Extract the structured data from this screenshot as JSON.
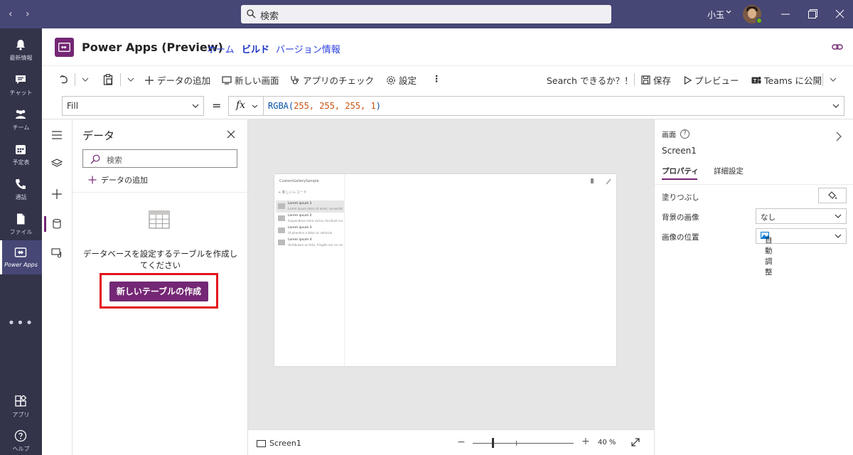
{
  "titlebar": {
    "search_placeholder": "検索",
    "user_name": "小玉"
  },
  "rail": {
    "items": [
      {
        "label": "最新情報",
        "icon": "bell-icon"
      },
      {
        "label": "チャット",
        "icon": "chat-icon"
      },
      {
        "label": "チーム",
        "icon": "teams-icon"
      },
      {
        "label": "予定表",
        "icon": "calendar-icon"
      },
      {
        "label": "通話",
        "icon": "phone-icon"
      },
      {
        "label": "ファイル",
        "icon": "file-icon"
      },
      {
        "label": "Power Apps",
        "icon": "power-apps-icon"
      },
      {
        "label": "アプリ",
        "icon": "apps-icon"
      },
      {
        "label": "ヘルプ",
        "icon": "help-icon"
      }
    ],
    "more": "•••"
  },
  "app_header": {
    "title": "Power Apps (Preview)",
    "nav": [
      "ホーム",
      "ビルド",
      "バージョン情報"
    ]
  },
  "toolbar": {
    "add_data": "データの追加",
    "new_screen": "新しい画面",
    "app_check": "アプリのチェック",
    "settings": "設定",
    "search": "Search できるか？！",
    "save": "保存",
    "preview": "プレビュー",
    "publish": "Teams に公開"
  },
  "formula_bar": {
    "property": "Fill",
    "fx": "fx",
    "formula_fn": "RGBA(",
    "formula_args": "255, 255, 255, 1",
    "formula_close": ")"
  },
  "data_panel": {
    "title": "データ",
    "search_placeholder": "検索",
    "add_data": "データの追加",
    "message": "データベースを設定するテーブルを作成してください",
    "create_button": "新しいテーブルの作成"
  },
  "canvas": {
    "screen_title": "CustomGallerySample",
    "add_record": "新しいレコード",
    "gallery": [
      {
        "title": "Lorem ipsum 1",
        "subtitle": "Lorem ipsum dolor sit amet, consectetur"
      },
      {
        "title": "Lorem ipsum 2",
        "subtitle": "Suspendisse enim varius, tincidunt sue"
      },
      {
        "title": "Lorem ipsum 3",
        "subtitle": "Ut pharetra a dolor ac vehicula"
      },
      {
        "title": "Lorem ipsum 4",
        "subtitle": "Vestibulum ou felis, fringilla nec ex nisi"
      }
    ]
  },
  "statusbar": {
    "screen_name": "Screen1",
    "zoom": "40 %",
    "zoom_level": 0.4
  },
  "properties": {
    "header": "画面",
    "name": "Screen1",
    "tabs": [
      "プロパティ",
      "詳細設定"
    ],
    "rows": [
      {
        "label": "塗りつぶし"
      },
      {
        "label": "背景の画像",
        "value": "なし"
      },
      {
        "label": "画像の位置",
        "value": "自動調整"
      }
    ]
  },
  "colors": {
    "teams_titlebar": "#464775",
    "teams_rail": "#33344a",
    "accent": "#742774",
    "highlight_outline": "#e3131b"
  }
}
